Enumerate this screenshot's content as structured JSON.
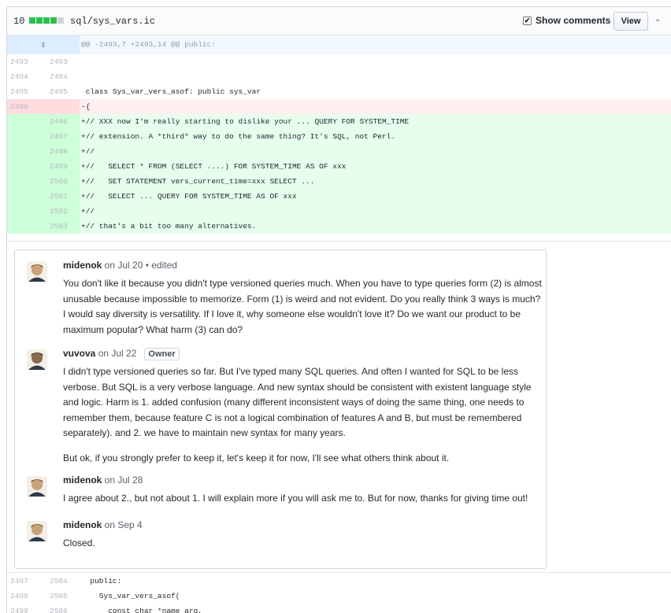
{
  "file": {
    "changes": "10",
    "path": "sql/sys_vars.ic",
    "diffstat_colors": [
      "#2cbe4e",
      "#2cbe4e",
      "#2cbe4e",
      "#2cbe4e",
      "#d1d5da"
    ],
    "show_comments_label": "Show comments",
    "show_comments_checked": "✔",
    "view_label": "View",
    "chevron": "⌄"
  },
  "hunk": {
    "expand_icon": "⇳",
    "header": "@@ -2493,7 +2493,14 @@ public:"
  },
  "lines_before": [
    {
      "old": "2493",
      "new": "2493",
      "code": ""
    },
    {
      "old": "2494",
      "new": "2494",
      "code": ""
    },
    {
      "old": "2495",
      "new": "2495",
      "code": " class Sys_var_vers_asof: public sys_var"
    }
  ],
  "deleted_line": {
    "old": "2496",
    "new": "",
    "code": "-{"
  },
  "added_lines": [
    {
      "old": "",
      "new": "2496",
      "code": "+// XXX now I'm really starting to dislike your ... QUERY FOR SYSTEM_TIME"
    },
    {
      "old": "",
      "new": "2497",
      "code": "+// extension. A *third* way to do the same thing? It's SQL, not Perl."
    },
    {
      "old": "",
      "new": "2498",
      "code": "+//"
    },
    {
      "old": "",
      "new": "2499",
      "code": "+//   SELECT * FROM (SELECT ....) FOR SYSTEM_TIME AS OF xxx"
    },
    {
      "old": "",
      "new": "2500",
      "code": "+//   SET STATEMENT vers_current_time=xxx SELECT ..."
    },
    {
      "old": "",
      "new": "2501",
      "code": "+//   SELECT ... QUERY FOR SYSTEM_TIME AS OF xxx"
    },
    {
      "old": "",
      "new": "2502",
      "code": "+//"
    },
    {
      "old": "",
      "new": "2503",
      "code": "+// that's a bit too many alternatives."
    }
  ],
  "comments": [
    {
      "author": "midenok",
      "meta": " on Jul 20 • edited",
      "badge": "",
      "paragraphs": [
        "You don't like it because you didn't type versioned queries much. When you have to type queries form (2) is almost unusable because impossible to memorize. Form (1) is weird and not evident. Do you really think 3 ways is much? I would say diversity is versatility. If I love it, why someone else wouldn't love it? Do we want our product to be maximum popular? What harm (3) can do?"
      ]
    },
    {
      "author": "vuvova",
      "meta": " on Jul 22",
      "badge": "Owner",
      "paragraphs": [
        "I didn't type versioned queries so far. But I've typed many SQL queries. And often I wanted for SQL to be less verbose. But SQL is a very verbose language. And new syntax should be consistent with existent language style and logic. Harm is 1. added confusion (many different inconsistent ways of doing the same thing, one needs to remember them, because feature C is not a logical combination of features A and B, but must be remembered separately). and 2. we have to maintain new syntax for many years.",
        "But ok, if you strongly prefer to keep it, let's keep it for now, I'll see what others think about it."
      ]
    },
    {
      "author": "midenok",
      "meta": " on Jul 28",
      "badge": "",
      "paragraphs": [
        "I agree about 2., but not about 1. I will explain more if you will ask me to. But for now, thanks for giving time out!"
      ]
    },
    {
      "author": "midenok",
      "meta": " on Sep 4",
      "badge": "",
      "paragraphs": [
        "Closed."
      ]
    }
  ],
  "lines_after": [
    {
      "old": "2497",
      "new": "2504",
      "code": "  public:"
    },
    {
      "old": "2498",
      "new": "2505",
      "code": "    Sys_var_vers_asof("
    },
    {
      "old": "2499",
      "new": "2506",
      "code": "      const char *name_arg,"
    }
  ]
}
